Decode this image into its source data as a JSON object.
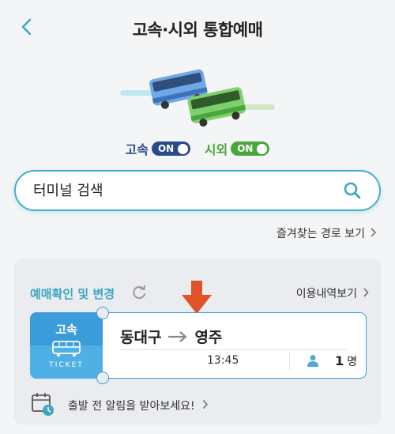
{
  "header": {
    "title": "고속·시외 통합예매",
    "back_icon": "chevron-left-icon"
  },
  "toggles": {
    "express": {
      "label": "고속",
      "state": "ON",
      "label_color": "#2b4a8b",
      "pill_color": "#2b4a8b"
    },
    "intercity": {
      "label": "시외",
      "state": "ON",
      "label_color": "#4aa63c",
      "pill_color": "#4aa63c"
    }
  },
  "search": {
    "placeholder": "터미널 검색",
    "value": "",
    "icon": "search-icon"
  },
  "favorites": {
    "label": "즐겨찾는 경로 보기"
  },
  "reservation": {
    "title": "예매확인 및 변경",
    "history_label": "이용내역보기",
    "ticket": {
      "bus_type": "고속",
      "stub_label": "TICKET",
      "origin": "동대구",
      "destination": "영주",
      "depart_time": "13:45",
      "passenger_count": "1",
      "passenger_unit": "명"
    },
    "alarm_text": "출발 전 알림을 받아보세요!"
  },
  "colors": {
    "accent": "#40b0c8",
    "ticket_blue": "#3a9dd9",
    "arrow_orange": "#e0522a",
    "express_navy": "#2b4a8b",
    "intercity_green": "#4aa63c"
  }
}
